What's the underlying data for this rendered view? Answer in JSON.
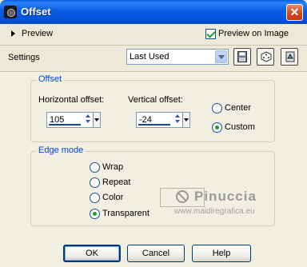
{
  "window": {
    "title": "Offset",
    "close_glyph": "✕"
  },
  "preview": {
    "label": "Preview",
    "preview_on_image_label": "Preview on Image",
    "preview_on_image_checked": true
  },
  "settings": {
    "label": "Settings",
    "preset_value": "Last Used",
    "icons": [
      "save-preset-icon",
      "randomize-dice-icon",
      "reset-icon"
    ]
  },
  "offset_group": {
    "title": "Offset",
    "horizontal_label": "Horizontal offset:",
    "horizontal_value": "105",
    "vertical_label": "Vertical offset:",
    "vertical_value": "-24",
    "options": [
      "Center",
      "Custom"
    ],
    "selected": "Custom"
  },
  "edge_mode": {
    "title": "Edge mode",
    "options": [
      "Wrap",
      "Repeat",
      "Color",
      "Transparent"
    ],
    "selected": "Transparent"
  },
  "watermark": {
    "name": "Pinuccia",
    "url": "www.maidiregrafica.eu"
  },
  "buttons": {
    "ok": "OK",
    "cancel": "Cancel",
    "help": "Help"
  },
  "colors": {
    "titlebar": "#0b5ce5",
    "accent_group_title": "#0046d5",
    "radio_check": "#21a121"
  }
}
